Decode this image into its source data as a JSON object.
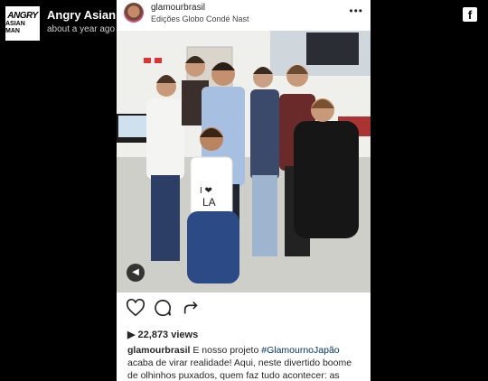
{
  "fb": {
    "page_logo_line1": "ANGRY",
    "page_logo_line2": "ASIAN MAN",
    "page_name": "Angry Asian Man",
    "post_time": "about a year ago",
    "facebook_icon": "f"
  },
  "instagram": {
    "username": "glamourbrasil",
    "location": "Edições Globo Condé Nast",
    "more": "•••",
    "views": "22,873 views",
    "caption_user": "glamourbrasil",
    "caption_text_1": " E nosso projeto ",
    "caption_hashtag": "#GlamournoJapão",
    "caption_text_2": " acaba de virar realidade! Aqui, neste divertido boome de olhinhos puxados, quem faz tudo acontecer: as",
    "shirt_text_top": "I ❤",
    "shirt_text_bottom": "LA"
  },
  "colors": {
    "instagram_bg": "#ffffff",
    "page_bg": "#000000",
    "shirt_heart": "#d8203a"
  }
}
